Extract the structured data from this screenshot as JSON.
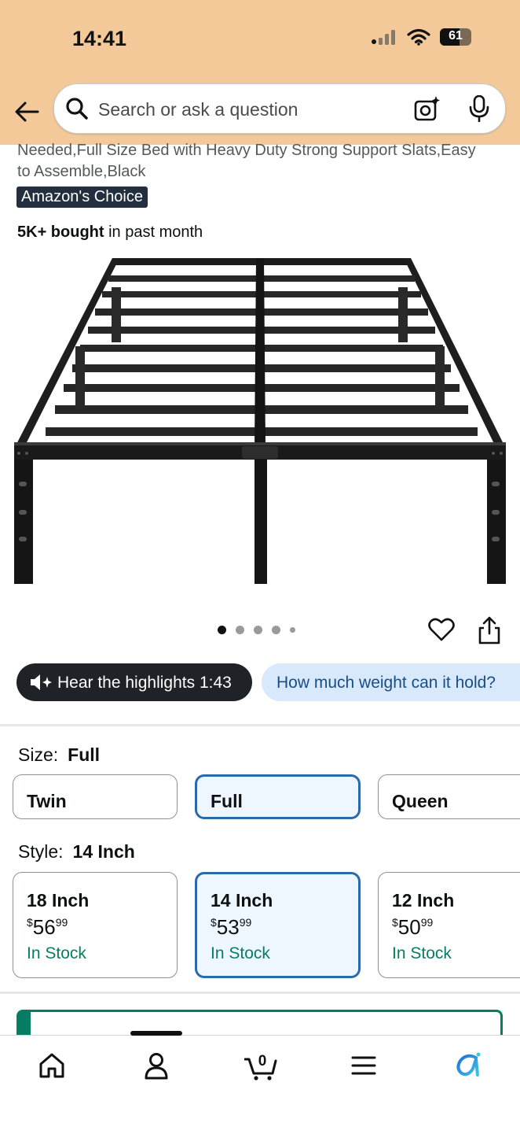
{
  "status": {
    "time": "14:41",
    "battery": "61"
  },
  "search": {
    "placeholder": "Search or ask a question"
  },
  "product": {
    "title_line1": "Needed,Full Size Bed with Heavy Duty Strong Support Slats,Easy",
    "title_line2": "to Assemble,Black",
    "badge": "Amazon's Choice",
    "bought_bold": "5K+ bought",
    "bought_rest": " in past month"
  },
  "gallery": {
    "total_dots": 5,
    "active_index": 0
  },
  "pills": {
    "hear": "Hear the highlights 1:43",
    "question": "How much weight can it hold?"
  },
  "size": {
    "label": "Size:",
    "selected": "Full",
    "options": [
      "Twin",
      "Full",
      "Queen"
    ]
  },
  "style": {
    "label": "Style:",
    "selected": "14 Inch",
    "options": [
      {
        "name": "18 Inch",
        "currency": "$",
        "price_whole": "56",
        "price_fraction": "99",
        "stock": "In Stock"
      },
      {
        "name": "14 Inch",
        "currency": "$",
        "price_whole": "53",
        "price_fraction": "99",
        "stock": "In Stock"
      },
      {
        "name": "12 Inch",
        "currency": "$",
        "price_whole": "50",
        "price_fraction": "99",
        "stock": "In Stock"
      }
    ]
  },
  "nav": {
    "items": [
      "home-icon",
      "account-icon",
      "cart-icon",
      "menu-icon",
      "rufus-icon"
    ],
    "cart_count": "0"
  },
  "colors": {
    "header_bg": "#f3c99a",
    "accent_blue": "#2a6aa8",
    "in_stock_green": "#067d62"
  }
}
